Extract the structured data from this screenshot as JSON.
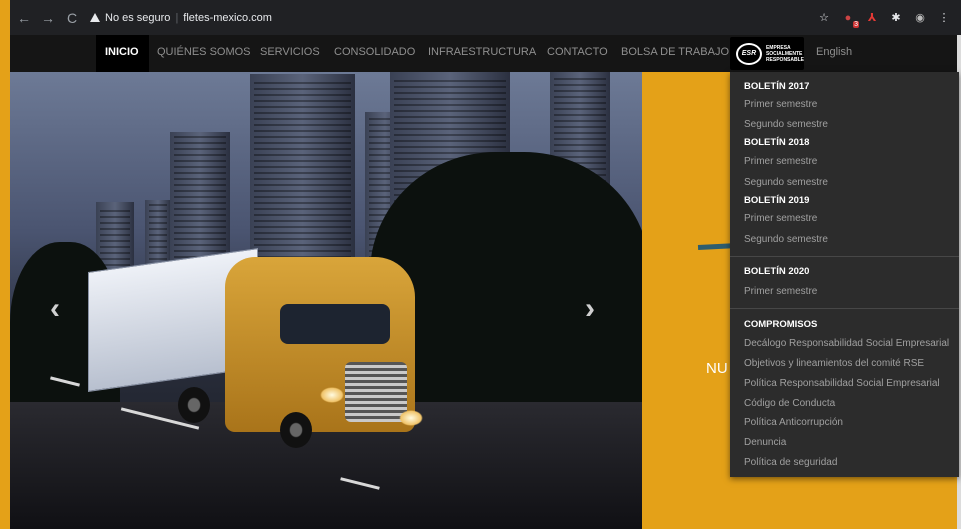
{
  "browser": {
    "security_label": "No es seguro",
    "url": "fletes-mexico.com",
    "badge_count": "3"
  },
  "nav": {
    "items": [
      {
        "label": "INICIO"
      },
      {
        "label": "QUIÉNES SOMOS"
      },
      {
        "label": "SERVICIOS"
      },
      {
        "label": "CONSOLIDADO"
      },
      {
        "label": "INFRAESTRUCTURA"
      },
      {
        "label": "CONTACTO"
      },
      {
        "label": "BOLSA DE TRABAJO"
      },
      {
        "label": "English"
      }
    ],
    "logo": {
      "mark": "ESR",
      "text_1": "EMPRESA",
      "text_2": "SOCIALMENTE",
      "text_3": "RESPONSABLE"
    }
  },
  "hero": {
    "side_text": "NU"
  },
  "dropdown": {
    "groups": [
      {
        "heading": "BOLETÍN 2017",
        "items": [
          "Primer semestre",
          "Segundo semestre"
        ]
      },
      {
        "heading": "BOLETÍN 2018",
        "items": [
          "Primer semestre",
          "Segundo semestre"
        ]
      },
      {
        "heading": "BOLETÍN 2019",
        "items": [
          "Primer semestre",
          "Segundo semestre"
        ]
      },
      {
        "heading": "BOLETÍN 2020",
        "items": [
          "Primer semestre"
        ]
      },
      {
        "heading": "COMPROMISOS",
        "items": [
          "Decálogo Responsabilidad Social Empresarial",
          "Objetivos y lineamientos del comité RSE",
          "Política Responsabilidad Social Empresarial",
          "Código de Conducta",
          "Política Anticorrupción",
          "Denuncia",
          "Política de seguridad"
        ]
      }
    ]
  },
  "colors": {
    "accent": "#e4a118",
    "nav_bg": "#151515",
    "dropdown_bg": "#2c2c2c"
  }
}
